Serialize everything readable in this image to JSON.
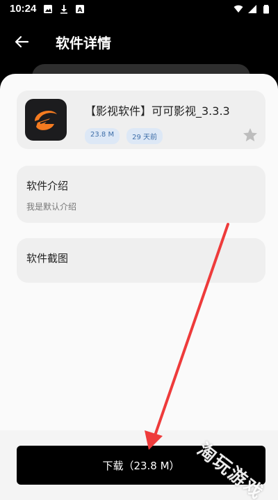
{
  "status_bar": {
    "time": "10:24",
    "icons_left": [
      "photo-icon",
      "download-icon",
      "image-icon"
    ],
    "icons_right": [
      "wifi-icon",
      "signal-icon",
      "battery-icon"
    ]
  },
  "app_bar": {
    "title": "软件详情",
    "back_icon": "arrow-left-icon"
  },
  "app_info": {
    "name": "【影视软件】可可影视_3.3.3",
    "size_chip": "23.8 M",
    "date_chip": "29 天前",
    "icon_bg": "#1c1c1e",
    "icon_accent": "#f47b20",
    "favorite_icon": "star-icon"
  },
  "intro": {
    "title": "软件介绍",
    "description": "我是默认介绍"
  },
  "screenshots": {
    "title": "软件截图"
  },
  "download": {
    "label": "下载（23.8 M）"
  },
  "annotation": {
    "arrow_color": "#ee3b3b"
  },
  "watermark": {
    "text": "淘玩游戏"
  }
}
